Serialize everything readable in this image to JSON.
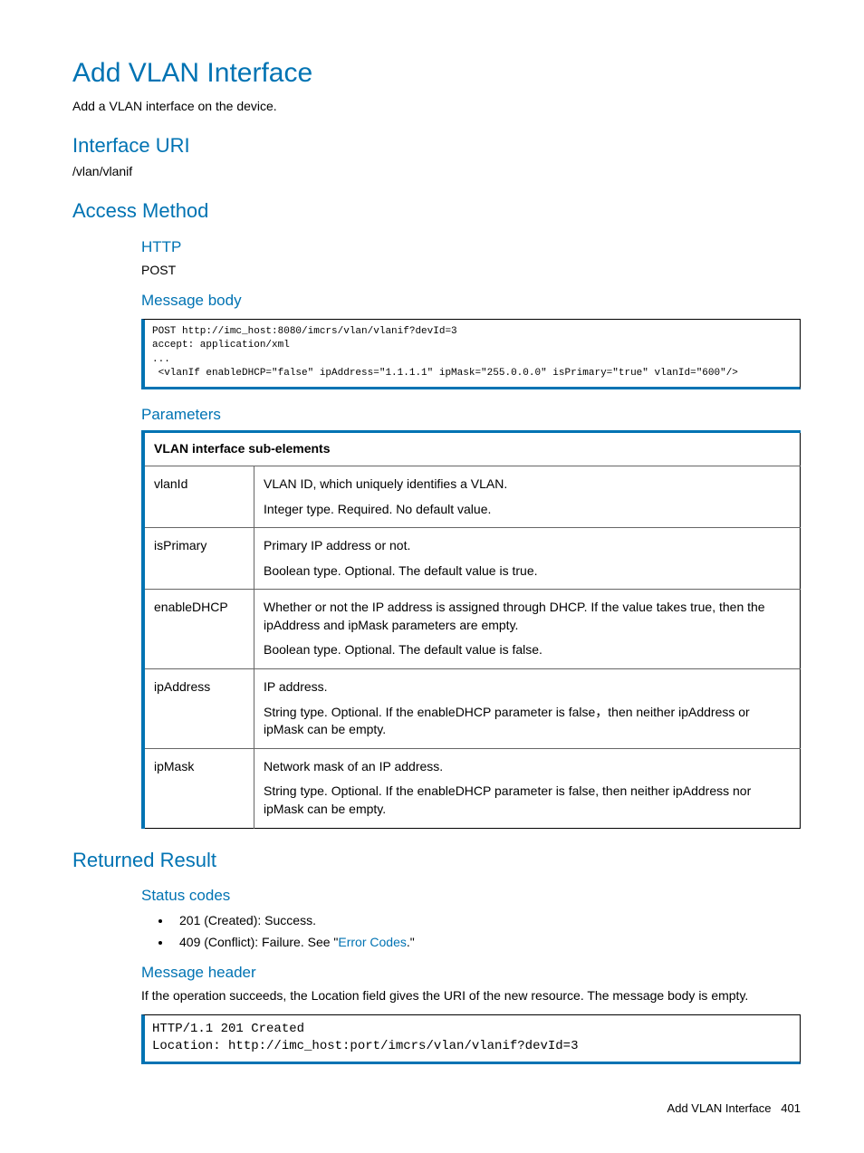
{
  "title": "Add VLAN Interface",
  "intro": "Add a VLAN interface on the device.",
  "sections": {
    "interface_uri": {
      "heading": "Interface URI",
      "value": "/vlan/vlanif"
    },
    "access_method": {
      "heading": "Access Method",
      "http_heading": "HTTP",
      "http_method": "POST",
      "msg_body_heading": "Message body",
      "msg_body_code": "POST http://imc_host:8080/imcrs/vlan/vlanif?devId=3\naccept: application/xml\n...\n <vlanIf enableDHCP=\"false\" ipAddress=\"1.1.1.1\" ipMask=\"255.0.0.0\" isPrimary=\"true\" vlanId=\"600\"/>",
      "parameters_heading": "Parameters",
      "table_header": "VLAN interface sub-elements",
      "rows": [
        {
          "name": "vlanId",
          "desc1": "VLAN ID, which uniquely identifies a VLAN.",
          "desc2": "Integer type. Required. No default value."
        },
        {
          "name": "isPrimary",
          "desc1": "Primary IP address or not.",
          "desc2": "Boolean type. Optional. The default value is true."
        },
        {
          "name": "enableDHCP",
          "desc1": "Whether or not the IP address is assigned through DHCP. If the value takes true, then the ipAddress and ipMask parameters are empty.",
          "desc2": "Boolean type. Optional. The default value is false."
        },
        {
          "name": "ipAddress",
          "desc1": "IP address.",
          "desc2": "String type. Optional. If the enableDHCP parameter is false，then neither ipAddress or ipMask can be empty."
        },
        {
          "name": "ipMask",
          "desc1": "Network mask of an IP address.",
          "desc2": "String type. Optional. If the enableDHCP parameter is false, then neither ipAddress nor ipMask can be empty."
        }
      ]
    },
    "returned_result": {
      "heading": "Returned Result",
      "status_heading": "Status codes",
      "status_items": {
        "s201": "201 (Created): Success.",
        "s409_pre": "409 (Conflict): Failure. See \"",
        "s409_link": "Error Codes",
        "s409_post": ".\""
      },
      "msg_header_heading": "Message header",
      "msg_header_text": "If the operation succeeds, the Location field gives the URI of the new resource. The message body is empty.",
      "msg_header_code": "HTTP/1.1 201 Created\nLocation: http://imc_host:port/imcrs/vlan/vlanif?devId=3"
    }
  },
  "footer": {
    "label": "Add VLAN Interface",
    "page": "401"
  }
}
